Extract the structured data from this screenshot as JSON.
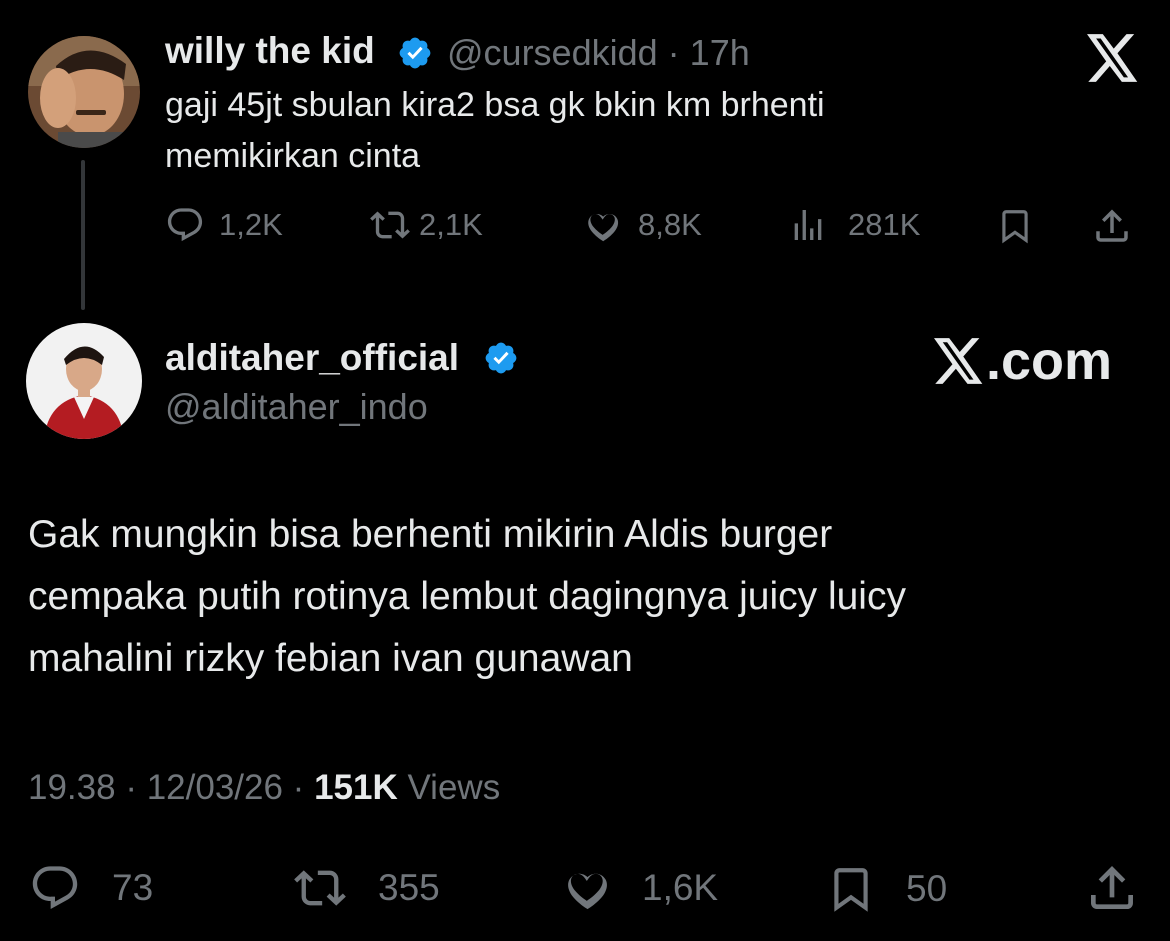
{
  "quoted_tweet": {
    "display_name": "willy the kid",
    "handle": "@cursedkidd",
    "separator": "·",
    "time": "17h",
    "text_line1": "gaji 45jt sbulan kira2 bsa gk bkin km brhenti",
    "text_line2": "memikirkan cinta",
    "actions": {
      "replies": "1,2K",
      "reposts": "2,1K",
      "likes": "8,8K",
      "views": "281K"
    }
  },
  "main_tweet": {
    "display_name": "alditaher_official",
    "handle": "@alditaher_indo",
    "watermark": ".com",
    "text_line1": "Gak mungkin bisa berhenti mikirin Aldis burger",
    "text_line2": "cempaka putih rotinya lembut dagingnya juicy luicy",
    "text_line3": "mahalini rizky febian ivan gunawan",
    "meta": {
      "time": "19.38",
      "sep1": " · ",
      "date": "12/03/26",
      "sep2": " · ",
      "views_count": "151K",
      "views_label": " Views"
    },
    "actions": {
      "replies": "73",
      "reposts": "355",
      "likes": "1,6K",
      "bookmarks": "50"
    }
  },
  "colors": {
    "background": "#000000",
    "text": "#e7e9ea",
    "secondary": "#71767b",
    "verified": "#1d9bf0"
  },
  "icons": [
    "x-logo-icon",
    "verified-badge-icon",
    "reply-icon",
    "repost-icon",
    "like-icon",
    "views-icon",
    "bookmark-icon",
    "share-icon"
  ]
}
